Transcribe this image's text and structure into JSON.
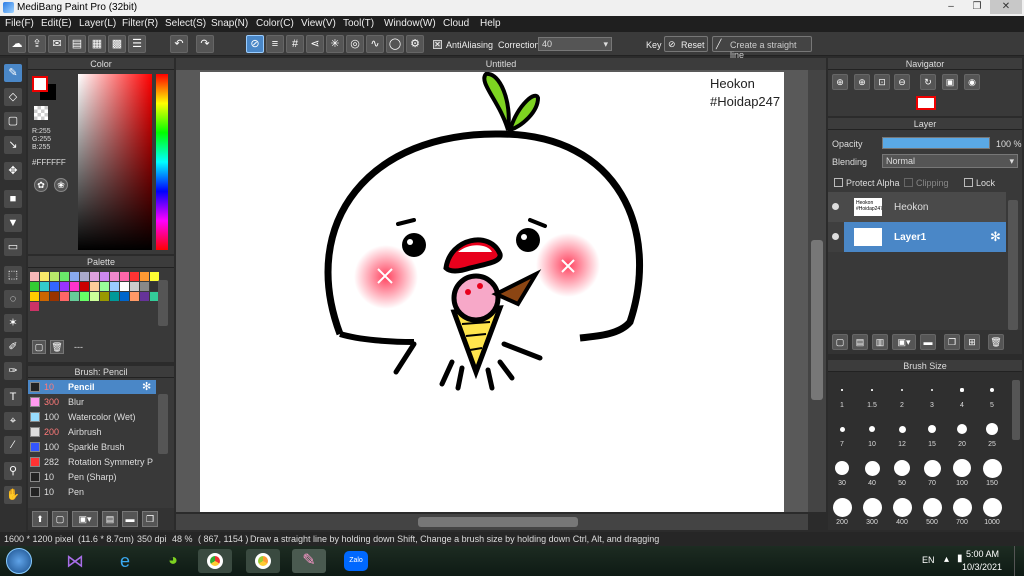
{
  "window": {
    "title": "MediBang Paint Pro (32bit)"
  },
  "menu": [
    "File(F)",
    "Edit(E)",
    "Layer(L)",
    "Filter(R)",
    "Select(S)",
    "Snap(N)",
    "Color(C)",
    "View(V)",
    "Tool(T)",
    "Window(W)",
    "Cloud",
    "Help"
  ],
  "toolbar": {
    "antialias": "AntiAliasing",
    "correction_label": "Correction",
    "correction_value": "40",
    "key_label": "Key",
    "reset": "Reset",
    "straight": "Create a straight line"
  },
  "color_panel": {
    "title": "Color",
    "r": "R:255",
    "g": "G:255",
    "b": "B:255",
    "hex": "#FFFFFF"
  },
  "palette_panel": {
    "title": "Palette",
    "footer": "---",
    "swatches": [
      "#f7b8b8",
      "#f8e86a",
      "#b8e86a",
      "#6ae86a",
      "#88aaee",
      "#aaaacc",
      "#dda0dd",
      "#cc88ee",
      "#ee88cc",
      "#ff66aa",
      "#ff3333",
      "#ff9933",
      "#ffff33",
      "#33cc33",
      "#33cccc",
      "#3366ff",
      "#9933ff",
      "#ff33cc",
      "#cc0000",
      "#ffcc99",
      "#99ff99",
      "#99ccff",
      "#ffffff",
      "#cccccc",
      "#888888",
      "#333333",
      "#ffcc00",
      "#cc6600",
      "#993300",
      "#ff6666",
      "#66cc99",
      "#66ff66",
      "#ccff99",
      "#999900",
      "#009999",
      "#0066cc",
      "#ff9966",
      "#663399",
      "#33cc99",
      "#cc3366"
    ]
  },
  "brush_panel": {
    "title": "Brush: Pencil",
    "items": [
      {
        "size": "10",
        "name": "Pencil",
        "color": "#222222",
        "selected": true
      },
      {
        "size": "300",
        "name": "Blur",
        "color": "#ff99ee"
      },
      {
        "size": "100",
        "name": "Watercolor (Wet)",
        "color": "#99ddff"
      },
      {
        "size": "200",
        "name": "Airbrush",
        "color": "#dddddd"
      },
      {
        "size": "100",
        "name": "Sparkle Brush",
        "color": "#3355ff"
      },
      {
        "size": "282",
        "name": "Rotation Symmetry P",
        "color": "#ff3333"
      },
      {
        "size": "10",
        "name": "Pen (Sharp)",
        "color": "#222222"
      },
      {
        "size": "10",
        "name": "Pen",
        "color": "#222222"
      }
    ]
  },
  "canvas": {
    "tab": "Untitled",
    "watermark_line1": "Heokon",
    "watermark_line2": "#Hoidap247"
  },
  "navigator": {
    "title": "Navigator"
  },
  "layer_panel": {
    "title": "Layer",
    "opacity_label": "Opacity",
    "opacity_value": "100 %",
    "opacity_fraction": 1.0,
    "blending_label": "Blending",
    "blending_value": "Normal",
    "protect_alpha": "Protect Alpha",
    "clipping": "Clipping",
    "lock": "Lock",
    "layers": [
      {
        "name": "Heokon",
        "thumb": "Heokon #Hoidap247",
        "selected": false
      },
      {
        "name": "Layer1",
        "selected": true
      }
    ]
  },
  "brush_size_panel": {
    "title": "Brush Size",
    "sizes": [
      "1",
      "1.5",
      "2",
      "3",
      "4",
      "5",
      "7",
      "10",
      "12",
      "15",
      "20",
      "25",
      "30",
      "40",
      "50",
      "70",
      "100",
      "150",
      "200",
      "300",
      "400",
      "500",
      "700",
      "1000"
    ]
  },
  "status": {
    "dims": "1600 * 1200 pixel",
    "physical": "(11.6 * 8.7cm)",
    "dpi": "350 dpi",
    "zoom": "48 %",
    "coords": "( 867, 1154 )",
    "hint": "Draw a straight line by holding down Shift, Change a brush size by holding down Ctrl, Alt, and dragging"
  },
  "taskbar": {
    "lang": "EN",
    "time": "5:00 AM",
    "date": "10/3/2021",
    "zalo": "Zalo"
  },
  "colors": {
    "accent": "#4a87c7",
    "cheek": "#ff4d6d",
    "leaf": "#7ed321",
    "cone": "#ffe54d",
    "mouth": "#e8001c"
  }
}
